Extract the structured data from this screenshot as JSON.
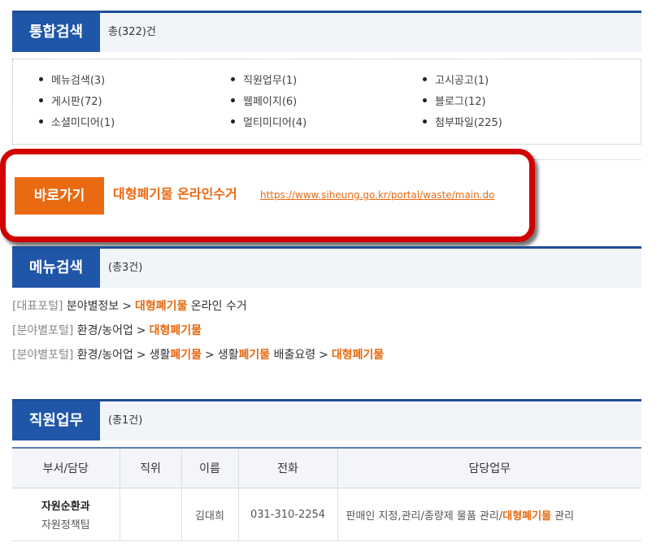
{
  "integrated": {
    "tag": "통합검색",
    "count": "총(322)건",
    "categories": [
      "메뉴검색(3)",
      "직원업무(1)",
      "고시공고(1)",
      "게시판(72)",
      "웹페이지(6)",
      "블로그(12)",
      "소셜미디어(1)",
      "멀티미디어(4)",
      "첨부파일(225)"
    ]
  },
  "shortcut": {
    "button": "바로가기",
    "title": "대형폐기물 온라인수거",
    "url": "https://www.siheung.go.kr/portal/waste/main.do"
  },
  "menu_search": {
    "tag": "메뉴검색",
    "count": "(총3건)",
    "results": [
      {
        "portal": "[대표포털]",
        "p1": "분야별정보",
        "p2": "대형폐기물",
        "p3": "온라인 수거"
      },
      {
        "portal": "[분야별포털]",
        "p1": "환경/농어업",
        "p2": "대형폐기물"
      },
      {
        "portal": "[분야별포털]",
        "p1": "환경/농어업",
        "p2a": "생활",
        "p2b": "폐기물",
        "p3a": "생활",
        "p3b": "폐기물",
        "p3c": "배출요령",
        "p4": "대형폐기물"
      }
    ],
    "arrow": ">"
  },
  "staff": {
    "tag": "직원업무",
    "count": "(총1건)",
    "headers": [
      "부서/담당",
      "직위",
      "이름",
      "전화",
      "담당업무"
    ],
    "rows": [
      {
        "dept": "자원순환과",
        "team": "자원정책팀",
        "position": "",
        "name": "김대희",
        "phone": "031-310-2254",
        "task_pre": "판매인 지정,관리/종량제 물품 관리/",
        "task_hl": "대형폐기물",
        "task_post": " 관리"
      }
    ]
  },
  "colors": {
    "blue": "#1f56a8",
    "orange": "#ea6a12",
    "red_frame": "#d10000"
  }
}
